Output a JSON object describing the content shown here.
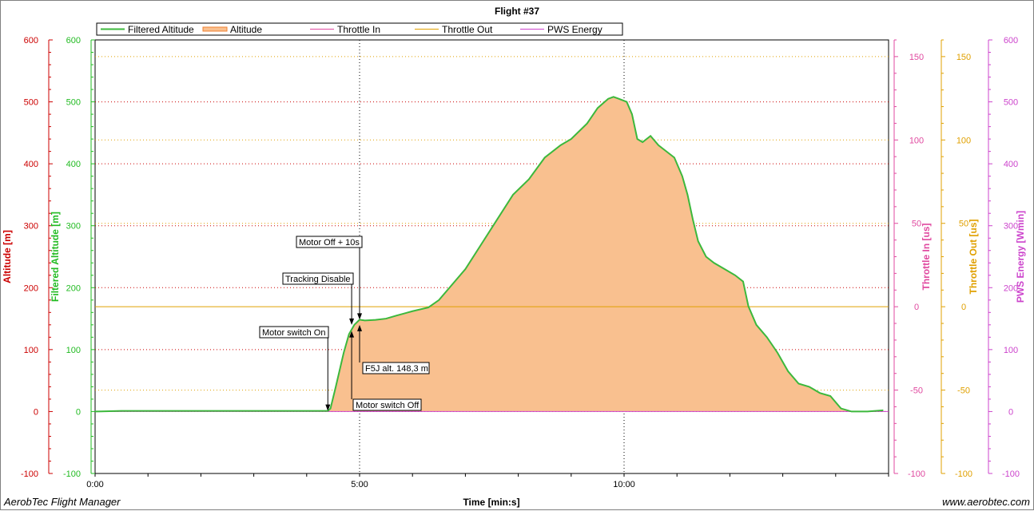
{
  "footer": {
    "app_name": "AerobTec Flight Manager",
    "website": "www.aerobtec.com"
  },
  "chart_data": {
    "type": "area",
    "title": "Flight #37",
    "xlabel": "Time [min:s]",
    "x_unit": "minutes",
    "xlim": [
      0,
      15
    ],
    "x_ticks": [
      0,
      5,
      10
    ],
    "x_tick_labels": [
      "0:00",
      "5:00",
      "10:00"
    ],
    "grid": true,
    "legend_position": "top",
    "axes": [
      {
        "label": "Altitude [m]",
        "side": "left",
        "color": "#cc0000",
        "range": [
          -100,
          600
        ],
        "ticks": [
          -100,
          0,
          100,
          200,
          300,
          400,
          500,
          600
        ]
      },
      {
        "label": "Filtered Altitude [m]",
        "side": "left",
        "color": "#22bb22",
        "range": [
          -100,
          600
        ],
        "ticks": [
          -100,
          0,
          100,
          200,
          300,
          400,
          500,
          600
        ]
      },
      {
        "label": "Throttle In [us]",
        "side": "right",
        "color": "#e04aa0",
        "range": [
          -100,
          160
        ],
        "ticks": [
          -100,
          -50,
          0,
          50,
          100,
          150
        ]
      },
      {
        "label": "Throttle Out [us]",
        "side": "right",
        "color": "#e0a000",
        "range": [
          -100,
          160
        ],
        "ticks": [
          -100,
          -50,
          0,
          50,
          100,
          150
        ]
      },
      {
        "label": "PWS Energy [Wmin]",
        "side": "right",
        "color": "#cc44cc",
        "range": [
          -100,
          600
        ],
        "ticks": [
          -100,
          0,
          100,
          200,
          300,
          400,
          500,
          600
        ]
      }
    ],
    "series": [
      {
        "name": "Filtered Altitude",
        "color": "#3cb83c",
        "x": [
          0,
          0.5,
          1,
          2,
          3,
          4,
          4.4,
          4.45,
          4.55,
          4.7,
          4.8,
          4.9,
          5.0,
          5.1,
          5.3,
          5.5,
          5.7,
          6.0,
          6.3,
          6.5,
          6.7,
          7.0,
          7.3,
          7.6,
          7.9,
          8.2,
          8.5,
          8.8,
          9.0,
          9.3,
          9.5,
          9.7,
          9.8,
          9.9,
          10.05,
          10.15,
          10.25,
          10.35,
          10.5,
          10.65,
          10.8,
          10.95,
          11.1,
          11.2,
          11.3,
          11.4,
          11.55,
          11.7,
          11.9,
          12.1,
          12.25,
          12.35,
          12.5,
          12.7,
          12.9,
          13.1,
          13.3,
          13.5,
          13.7,
          13.9,
          14.1,
          14.3,
          14.6,
          14.9
        ],
        "y": [
          0,
          1,
          1,
          1,
          1,
          1,
          1,
          5,
          40,
          95,
          125,
          140,
          148.3,
          147,
          148,
          150,
          155,
          162,
          168,
          180,
          200,
          230,
          270,
          310,
          350,
          375,
          410,
          430,
          440,
          465,
          490,
          505,
          508,
          505,
          500,
          480,
          440,
          435,
          445,
          430,
          420,
          410,
          380,
          350,
          310,
          275,
          250,
          240,
          230,
          220,
          210,
          170,
          140,
          120,
          95,
          65,
          45,
          40,
          30,
          25,
          5,
          0,
          0,
          2
        ]
      },
      {
        "name": "Altitude",
        "color": "#f08030",
        "fill": "#f9c08f",
        "x": [
          0,
          0.5,
          1,
          2,
          3,
          4,
          4.4,
          4.45,
          4.55,
          4.7,
          4.8,
          4.9,
          5.0,
          5.1,
          5.3,
          5.5,
          5.7,
          6.0,
          6.3,
          6.5,
          6.7,
          7.0,
          7.3,
          7.6,
          7.9,
          8.2,
          8.5,
          8.8,
          9.0,
          9.3,
          9.5,
          9.7,
          9.8,
          9.9,
          10.05,
          10.15,
          10.25,
          10.35,
          10.5,
          10.65,
          10.8,
          10.95,
          11.1,
          11.2,
          11.3,
          11.4,
          11.55,
          11.7,
          11.9,
          12.1,
          12.25,
          12.35,
          12.5,
          12.7,
          12.9,
          13.1,
          13.3,
          13.5,
          13.7,
          13.9,
          14.1,
          14.3,
          14.6,
          14.9
        ],
        "y": [
          0,
          1,
          1,
          1,
          1,
          1,
          1,
          5,
          40,
          95,
          125,
          140,
          148.3,
          147,
          148,
          150,
          155,
          162,
          168,
          180,
          200,
          230,
          270,
          310,
          350,
          375,
          410,
          430,
          440,
          465,
          490,
          505,
          508,
          505,
          500,
          480,
          440,
          435,
          445,
          430,
          420,
          410,
          380,
          350,
          310,
          275,
          250,
          240,
          230,
          220,
          210,
          170,
          140,
          120,
          95,
          65,
          45,
          40,
          30,
          25,
          5,
          0,
          0,
          2
        ]
      },
      {
        "name": "Throttle In",
        "color": "#e04aa0",
        "x": [
          0,
          15
        ],
        "y": [
          null,
          null
        ]
      },
      {
        "name": "Throttle Out",
        "color": "#e0a000",
        "axis_index": 3,
        "x": [
          0,
          15
        ],
        "y": [
          0,
          0
        ]
      },
      {
        "name": "PWS Energy",
        "color": "#cc44cc",
        "x": [
          0,
          15
        ],
        "y": [
          0,
          0
        ]
      }
    ],
    "markers": [
      {
        "label": "Motor switch On",
        "x": 4.4,
        "direction": "down",
        "y": 1
      },
      {
        "label": "Tracking Disable",
        "x": 4.85,
        "direction": "down",
        "y": 140
      },
      {
        "label": "Motor switch Off",
        "x": 4.85,
        "direction": "up",
        "y": 130
      },
      {
        "label": "Motor Off + 10s",
        "x": 5.0,
        "direction": "down",
        "y": 148.3
      },
      {
        "label": "F5J alt. 148,3 m",
        "x": 5.0,
        "direction": "up",
        "y": 140
      }
    ],
    "vertical_lines": [
      5.0,
      10.0
    ]
  }
}
